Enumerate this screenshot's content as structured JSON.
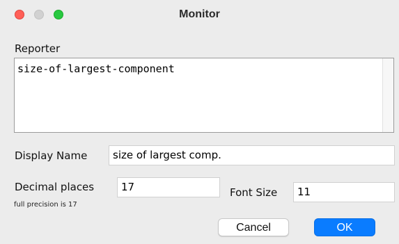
{
  "window": {
    "title": "Monitor",
    "traffic_lights": {
      "close": "#ff5f57",
      "minimize": "#d1d1d1",
      "maximize": "#28c840"
    }
  },
  "reporter": {
    "label": "Reporter",
    "value": "size-of-largest-component"
  },
  "display_name": {
    "label": "Display Name",
    "value": "size of largest comp."
  },
  "decimal_places": {
    "label": "Decimal places",
    "value": "17",
    "hint": "full precision is 17"
  },
  "font_size": {
    "label": "Font Size",
    "value": "11"
  },
  "buttons": {
    "cancel": "Cancel",
    "ok": "OK",
    "ok_color": "#0a7cff"
  }
}
